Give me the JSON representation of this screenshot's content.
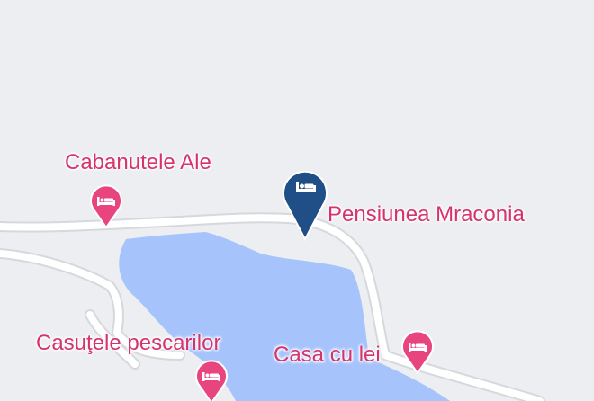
{
  "map": {
    "colors": {
      "land": "#eceef1",
      "water": "#a6c4fb",
      "road": "#ffffff",
      "road_casing": "#d5d8dc",
      "poi_pink": "#e8457e",
      "label_pink": "#d6336c",
      "selected_blue": "#1f4f86"
    },
    "places": [
      {
        "name": "Cabanutele Ale",
        "icon": "hotel-bed-icon"
      },
      {
        "name": "Pensiunea Mraconia",
        "icon": "hotel-bed-icon",
        "selected": true
      },
      {
        "name": "Casuţele pescarilor",
        "icon": "hotel-bed-icon"
      },
      {
        "name": "Casa cu lei",
        "icon": "hotel-bed-icon"
      }
    ]
  }
}
